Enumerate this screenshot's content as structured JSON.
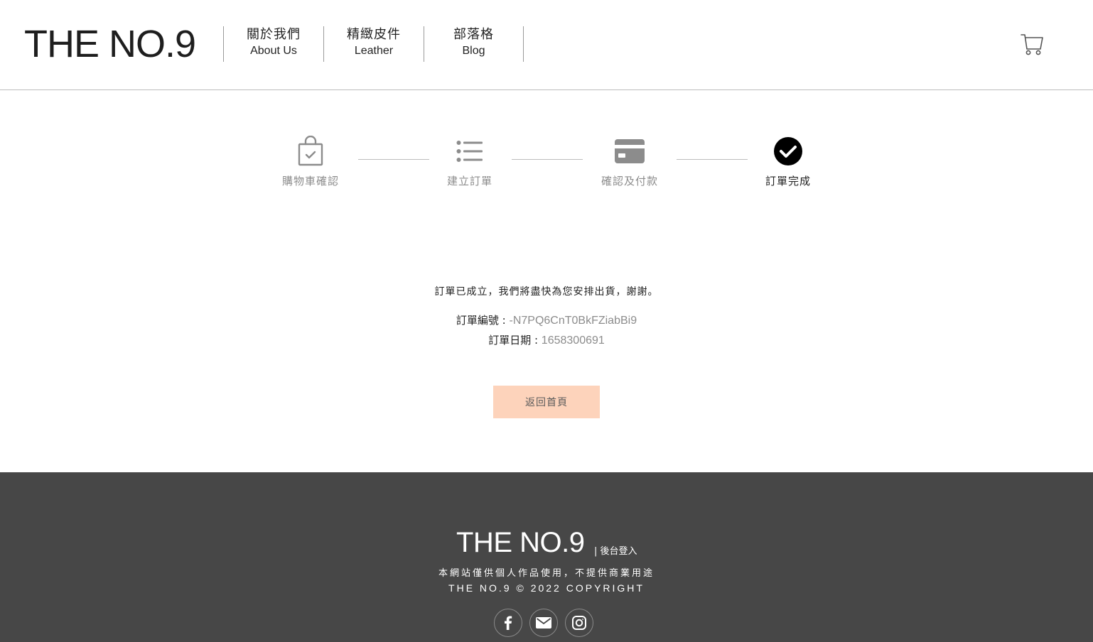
{
  "brand": {
    "logo": "THE NO.9"
  },
  "nav": {
    "items": [
      {
        "zh": "關於我們",
        "en": "About Us"
      },
      {
        "zh": "精緻皮件",
        "en": "Leather"
      },
      {
        "zh": "部落格",
        "en": "Blog"
      }
    ]
  },
  "header": {
    "cart_icon": "cart-icon"
  },
  "steps": [
    {
      "label": "購物車確認",
      "icon": "shopping-bag-check-icon",
      "active": false
    },
    {
      "label": "建立訂單",
      "icon": "list-icon",
      "active": false
    },
    {
      "label": "確認及付款",
      "icon": "credit-card-icon",
      "active": false
    },
    {
      "label": "訂單完成",
      "icon": "check-circle-icon",
      "active": true
    }
  ],
  "order": {
    "message": "訂單已成立，我們將盡快為您安排出貨，謝謝。",
    "number_label": "訂單編號 : ",
    "number_value": "-N7PQ6CnT0BkFZiabBi9",
    "date_label": "訂單日期 : ",
    "date_value": "1658300691",
    "home_button": "返回首頁"
  },
  "colors": {
    "button_bg": "#fdd3bb",
    "footer_bg": "#474747",
    "muted": "#8c8c8c"
  },
  "footer": {
    "logo": "THE NO.9",
    "admin_link": "| 後台登入",
    "note": "本網站僅供個人作品使用，不提供商業用途",
    "copyright": "THE NO.9 © 2022 COPYRIGHT",
    "social": [
      "facebook-icon",
      "email-icon",
      "instagram-icon"
    ]
  }
}
